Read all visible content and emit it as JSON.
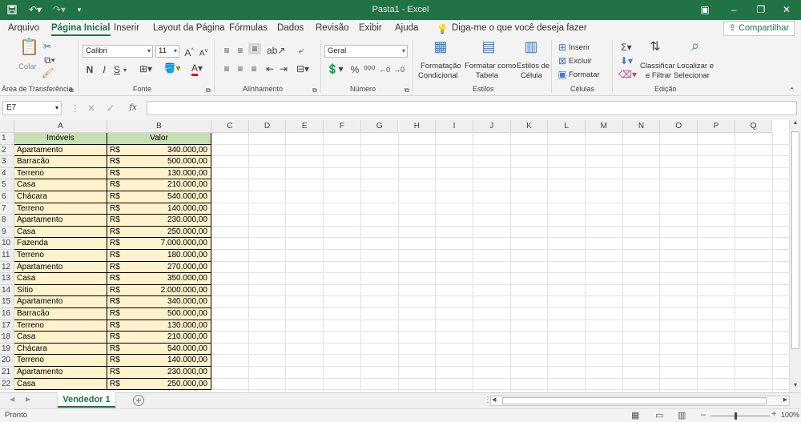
{
  "titlebar": {
    "title": "Pasta1  -  Excel",
    "save_icon": "save-icon",
    "undo_icon": "undo-icon",
    "redo_icon": "redo-icon",
    "customize_icon": "customize-icon"
  },
  "menubar": {
    "tabs": [
      "Arquivo",
      "Página Inicial",
      "Inserir",
      "Layout da Página",
      "Fórmulas",
      "Dados",
      "Revisão",
      "Exibir",
      "Ajuda"
    ],
    "active": "Página Inicial",
    "tell_me": "Diga-me o que você deseja fazer",
    "share": "Compartilhar"
  },
  "ribbon": {
    "clipboard": {
      "paste": "Colar",
      "label": "Área de Transferência"
    },
    "font": {
      "name": "Calibri",
      "size": "11",
      "bold": "N",
      "italic": "I",
      "underline": "S",
      "label": "Fonte"
    },
    "alignment": {
      "label": "Alinhamento"
    },
    "number": {
      "format": "Geral",
      "percent": "%",
      "label": "Número"
    },
    "styles": {
      "cond_format_1": "Formatação",
      "cond_format_2": "Condicional",
      "format_table_1": "Formatar como",
      "format_table_2": "Tabela",
      "cell_styles_1": "Estilos de",
      "cell_styles_2": "Célula",
      "label": "Estilos"
    },
    "cells": {
      "insert": "Inserir",
      "delete": "Excluir",
      "format": "Formatar",
      "label": "Células"
    },
    "editing": {
      "sort_1": "Classificar",
      "sort_2": "e Filtrar",
      "find_1": "Localizar e",
      "find_2": "Selecionar",
      "label": "Edição"
    }
  },
  "formula_bar": {
    "name_box": "E7",
    "fx": "fx",
    "value": ""
  },
  "columns": [
    "A",
    "B",
    "C",
    "D",
    "E",
    "F",
    "G",
    "H",
    "I",
    "J",
    "K",
    "L",
    "M",
    "N",
    "O",
    "P",
    "Q"
  ],
  "header_row": {
    "a": "Imóveis",
    "b": "Valor"
  },
  "rows": [
    {
      "n": "2",
      "type": "Apartamento",
      "cur": "R$",
      "val": "340.000,00"
    },
    {
      "n": "3",
      "type": "Barracão",
      "cur": "R$",
      "val": "500.000,00"
    },
    {
      "n": "4",
      "type": "Terreno",
      "cur": "R$",
      "val": "130.000,00"
    },
    {
      "n": "5",
      "type": "Casa",
      "cur": "R$",
      "val": "210.000,00"
    },
    {
      "n": "6",
      "type": "Chácara",
      "cur": "R$",
      "val": "540.000,00"
    },
    {
      "n": "7",
      "type": "Terreno",
      "cur": "R$",
      "val": "140.000,00"
    },
    {
      "n": "8",
      "type": "Apartamento",
      "cur": "R$",
      "val": "230.000,00"
    },
    {
      "n": "9",
      "type": "Casa",
      "cur": "R$",
      "val": "250.000,00"
    },
    {
      "n": "10",
      "type": "Fazenda",
      "cur": "R$",
      "val": "7.000.000,00"
    },
    {
      "n": "11",
      "type": "Terreno",
      "cur": "R$",
      "val": "180.000,00"
    },
    {
      "n": "12",
      "type": "Apartamento",
      "cur": "R$",
      "val": "270.000,00"
    },
    {
      "n": "13",
      "type": "Casa",
      "cur": "R$",
      "val": "350.000,00"
    },
    {
      "n": "14",
      "type": "Sítio",
      "cur": "R$",
      "val": "2.000.000,00"
    },
    {
      "n": "15",
      "type": "Apartamento",
      "cur": "R$",
      "val": "340.000,00"
    },
    {
      "n": "16",
      "type": "Barracão",
      "cur": "R$",
      "val": "500.000,00"
    },
    {
      "n": "17",
      "type": "Terreno",
      "cur": "R$",
      "val": "130.000,00"
    },
    {
      "n": "18",
      "type": "Casa",
      "cur": "R$",
      "val": "210.000,00"
    },
    {
      "n": "19",
      "type": "Chácara",
      "cur": "R$",
      "val": "540.000,00"
    },
    {
      "n": "20",
      "type": "Terreno",
      "cur": "R$",
      "val": "140.000,00"
    },
    {
      "n": "21",
      "type": "Apartamento",
      "cur": "R$",
      "val": "230.000,00"
    },
    {
      "n": "22",
      "type": "Casa",
      "cur": "R$",
      "val": "250.000,00"
    }
  ],
  "sheet": {
    "tab": "Vendedor 1",
    "add": "+"
  },
  "status": {
    "ready": "Pronto",
    "zoom": "100%"
  },
  "colors": {
    "brand": "#217346",
    "header_fill": "#c6e0b4",
    "data_fill": "#fff2cc"
  }
}
